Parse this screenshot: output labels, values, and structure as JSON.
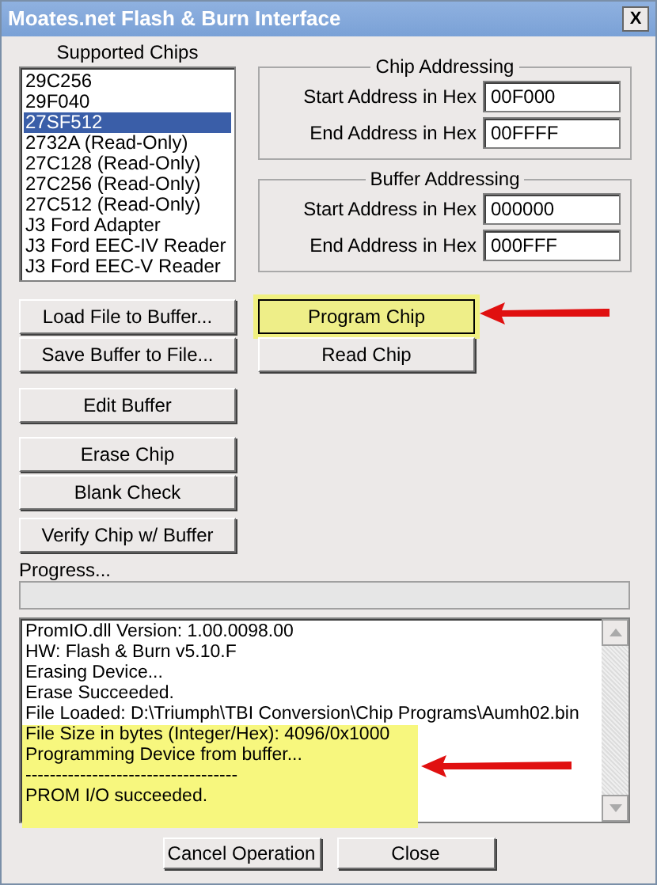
{
  "window": {
    "title": "Moates.net Flash & Burn Interface",
    "close": "X"
  },
  "supported_chips": {
    "label": "Supported Chips",
    "items": [
      {
        "text": "29C256",
        "selected": false
      },
      {
        "text": "29F040",
        "selected": false
      },
      {
        "text": "27SF512",
        "selected": true
      },
      {
        "text": "2732A (Read-Only)",
        "selected": false
      },
      {
        "text": "27C128 (Read-Only)",
        "selected": false
      },
      {
        "text": "27C256 (Read-Only)",
        "selected": false
      },
      {
        "text": "27C512 (Read-Only)",
        "selected": false
      },
      {
        "text": "J3 Ford Adapter",
        "selected": false
      },
      {
        "text": "J3 Ford EEC-IV Reader",
        "selected": false
      },
      {
        "text": "J3 Ford EEC-V Reader",
        "selected": false
      }
    ]
  },
  "groups": [
    {
      "title": "Chip Addressing",
      "fields": [
        {
          "label": "Start Address in Hex",
          "value": "00F000"
        },
        {
          "label": "End Address in Hex",
          "value": "00FFFF"
        }
      ]
    },
    {
      "title": "Buffer Addressing",
      "fields": [
        {
          "label": "Start Address in Hex",
          "value": "000000"
        },
        {
          "label": "End Address in Hex",
          "value": "000FFF"
        }
      ]
    }
  ],
  "left_buttons": [
    [
      {
        "label": "Load File to Buffer..."
      },
      {
        "label": "Save Buffer to File..."
      }
    ],
    [
      {
        "label": "Edit Buffer"
      }
    ],
    [
      {
        "label": "Erase Chip"
      },
      {
        "label": "Blank Check"
      }
    ],
    [
      {
        "label": "Verify Chip w/ Buffer"
      }
    ]
  ],
  "right_buttons": [
    {
      "label": "Program Chip",
      "highlighted": true
    },
    {
      "label": "Read Chip",
      "highlighted": false
    }
  ],
  "progress": {
    "label": "Progress...",
    "level": 0
  },
  "log": [
    {
      "text": "PromIO.dll Version: 1.00.0098.00",
      "highlighted": false
    },
    {
      "text": "HW: Flash & Burn v5.10.F",
      "highlighted": false
    },
    {
      "text": "Erasing Device...",
      "highlighted": false
    },
    {
      "text": "Erase Succeeded.",
      "highlighted": false
    },
    {
      "text": "File Loaded: D:\\Triumph\\TBI Conversion\\Chip Programs\\Aumh02.bin",
      "highlighted": false
    },
    {
      "text": "File Size in bytes (Integer/Hex): 4096/0x1000",
      "highlighted": true
    },
    {
      "text": "Programming Device from buffer...",
      "highlighted": true
    },
    {
      "text": "-----------------------------------",
      "highlighted": true
    },
    {
      "text": "PROM I/O succeeded.",
      "highlighted": true
    }
  ],
  "bottom_buttons": [
    {
      "label": "Cancel Operation"
    },
    {
      "label": "Close"
    }
  ]
}
